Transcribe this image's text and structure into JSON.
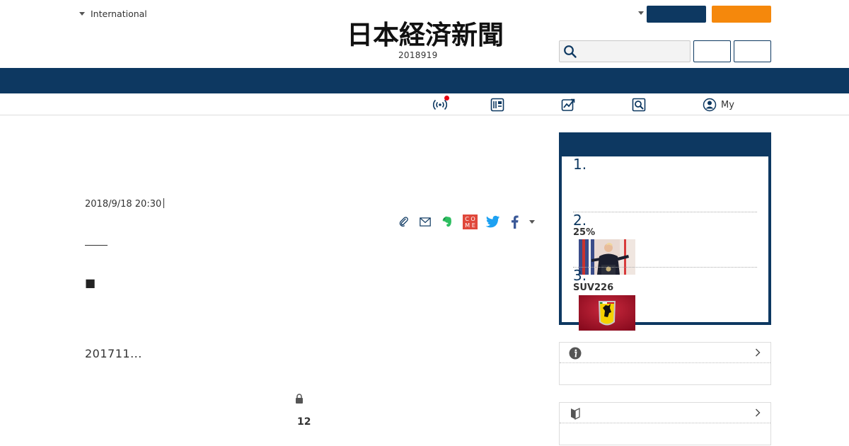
{
  "header": {
    "region_label": "International",
    "edition_date": "2018919",
    "logo_text": "日本経済新聞",
    "search_placeholder": ""
  },
  "subnav": {
    "items": [
      {
        "icon": "broadcast-icon",
        "label": ""
      },
      {
        "icon": "newspaper-icon",
        "label": ""
      },
      {
        "icon": "market-chart-icon",
        "label": ""
      },
      {
        "icon": "search-icon",
        "label": ""
      },
      {
        "icon": "user-icon",
        "label": "My"
      }
    ]
  },
  "article": {
    "timestamp": "2018/9/18 20:30",
    "dash": "——",
    "square_marker": "■",
    "teaser": "201711...",
    "paywall_number": "12"
  },
  "share": {
    "icons": [
      "clip-icon",
      "mail-icon",
      "evernote-icon",
      "come-icon",
      "twitter-icon",
      "facebook-icon",
      "more-caret-icon"
    ],
    "come_text": "CO ME"
  },
  "ranking": {
    "items": [
      {
        "rank": "1.",
        "title": ""
      },
      {
        "rank": "2.",
        "title": "25%",
        "image": "press-conference-photo"
      },
      {
        "rank": "3.",
        "title": "SUV226",
        "image": "ferrari-logo-photo"
      }
    ]
  },
  "sideboxes": [
    {
      "icon": "info-icon"
    },
    {
      "icon": "beginner-mark-icon"
    }
  ],
  "colors": {
    "navy": "#0d3861",
    "orange": "#f5880c",
    "alert_red": "#e60012",
    "evernote_green": "#2dbe60",
    "come_red": "#e0483b",
    "twitter_blue": "#1da1f2",
    "facebook_navy": "#3b5998"
  }
}
